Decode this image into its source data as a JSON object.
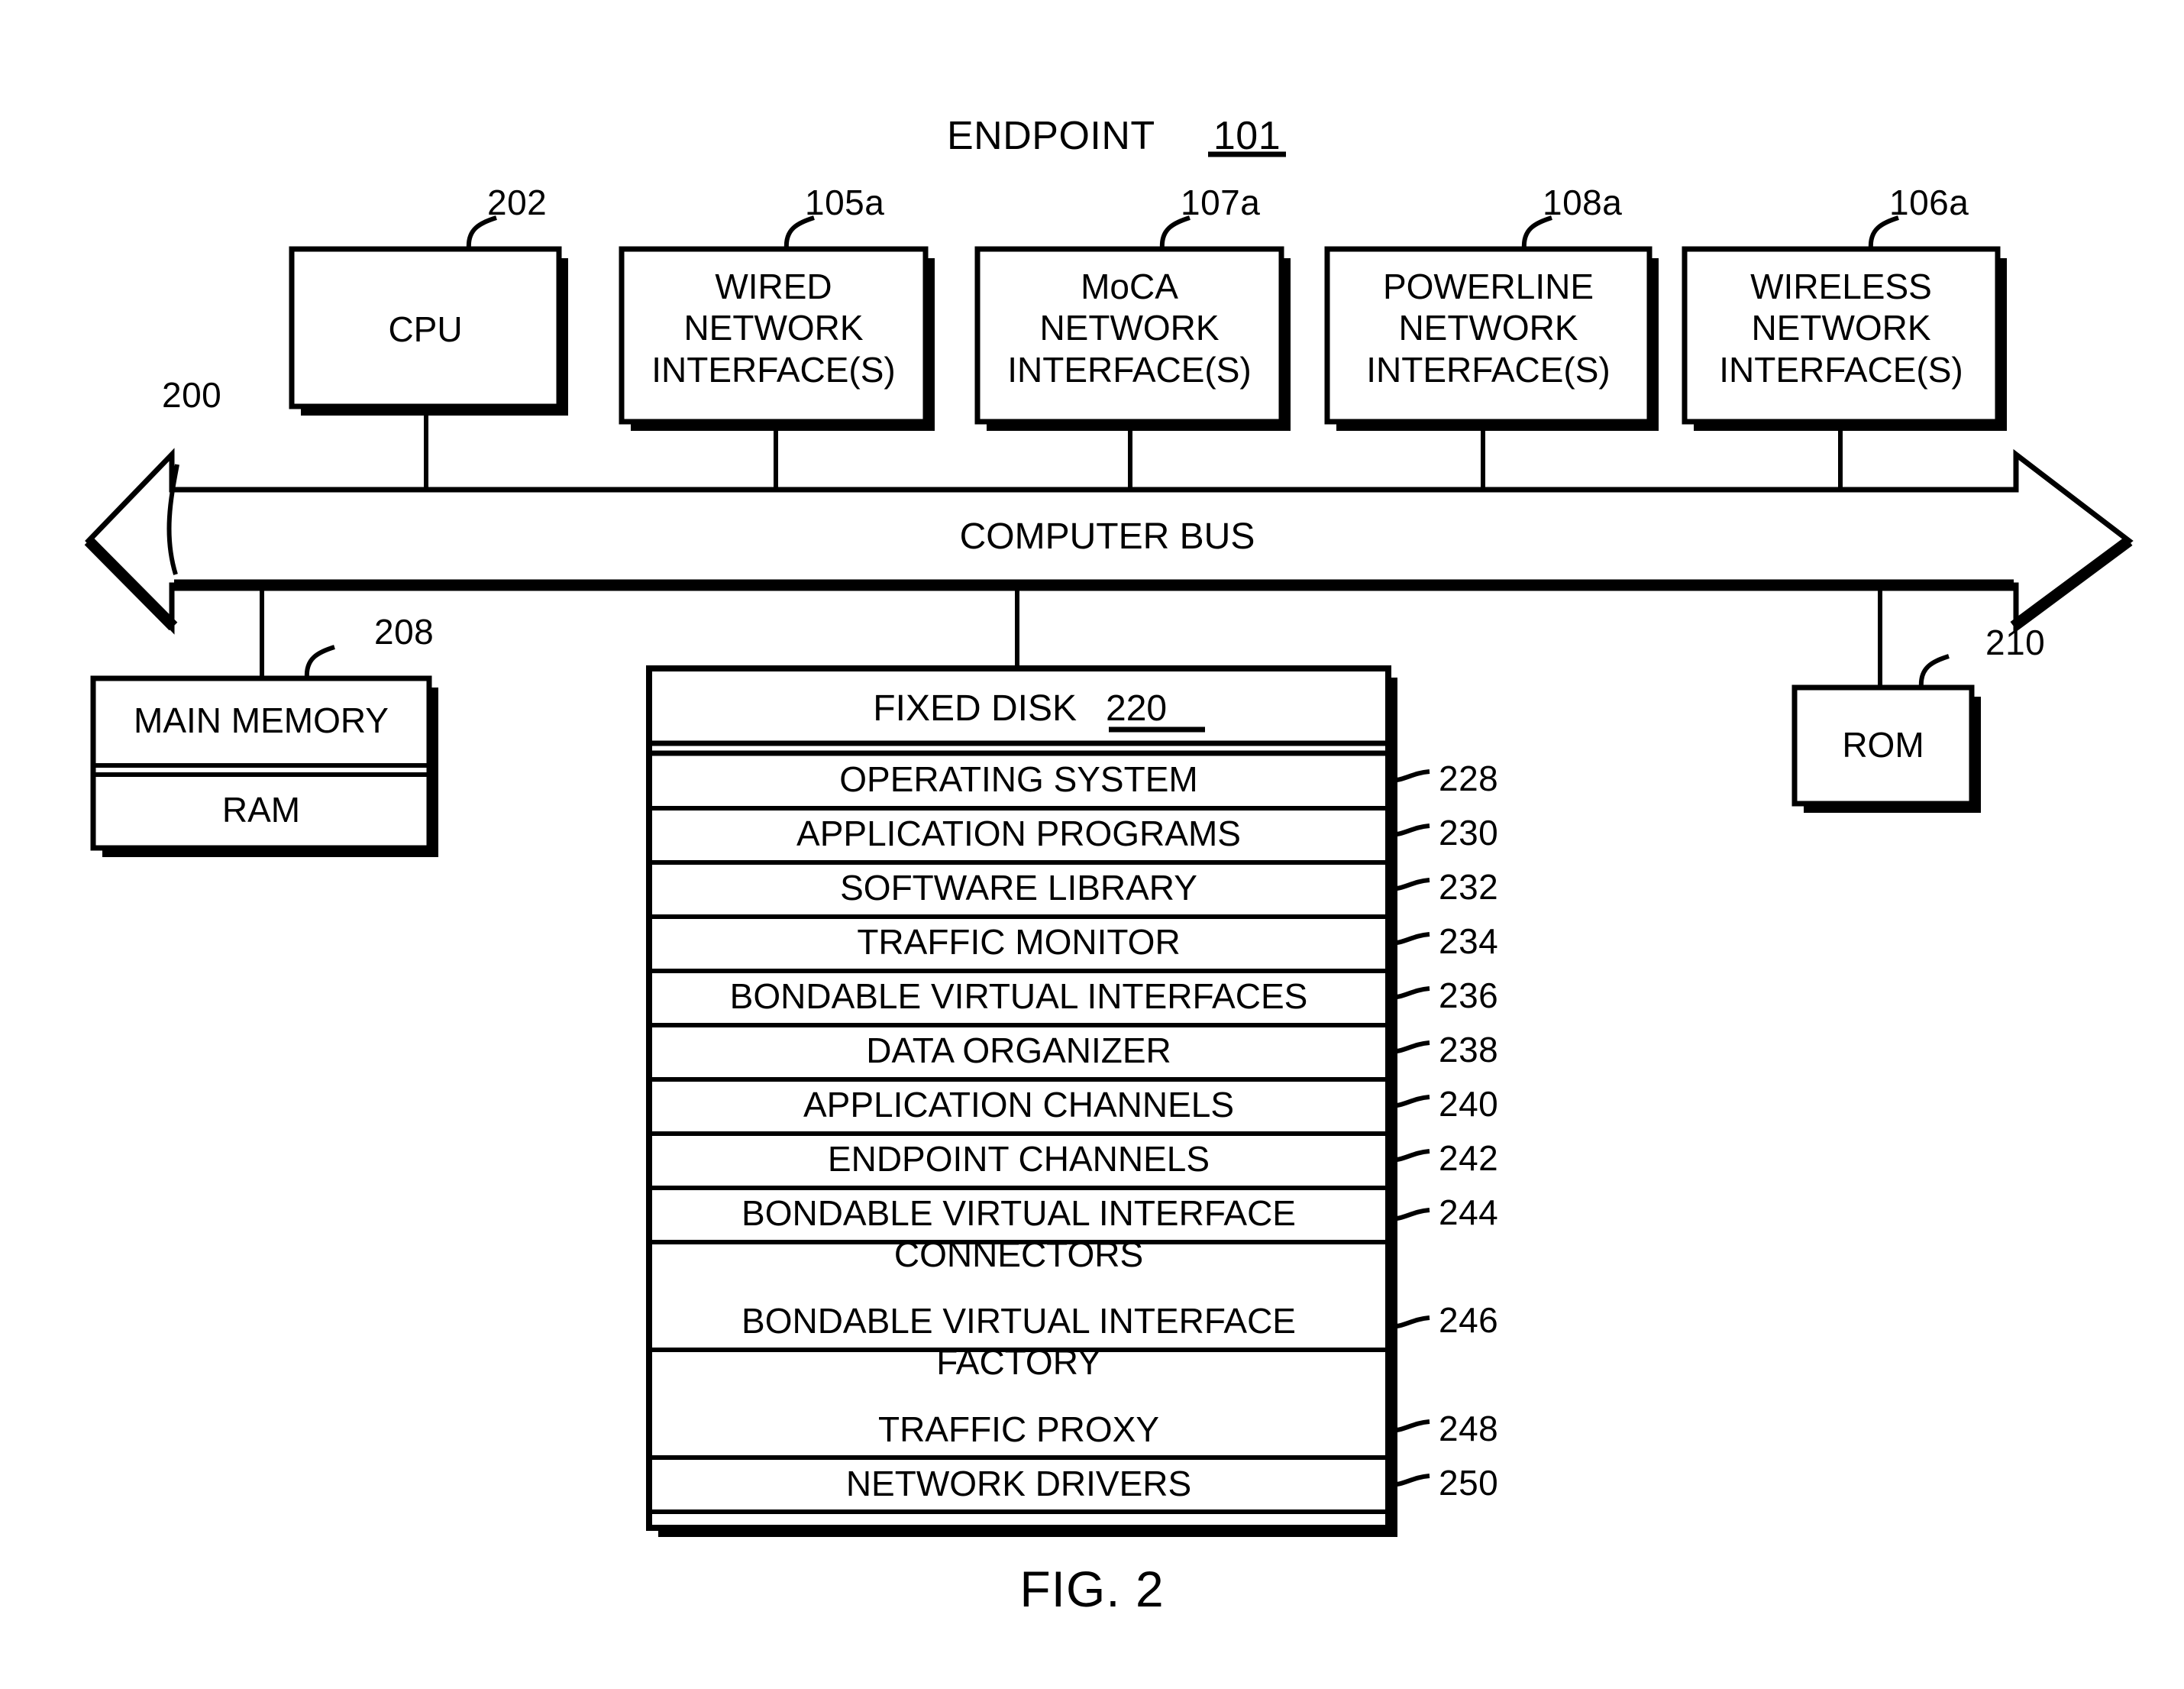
{
  "figure": {
    "title_text": "ENDPOINT",
    "title_ref": "101",
    "caption": "FIG. 2",
    "bus_label": "COMPUTER BUS",
    "bus_ref": "200"
  },
  "top_boxes": [
    {
      "label": "CPU",
      "ref": "202"
    },
    {
      "label": "WIRED\nNETWORK\nINTERFACE(S)",
      "ref": "105a"
    },
    {
      "label": "MoCA\nNETWORK\nINTERFACE(S)",
      "ref": "107a"
    },
    {
      "label": "POWERLINE\nNETWORK\nINTERFACE(S)",
      "ref": "108a"
    },
    {
      "label": "WIRELESS\nNETWORK\nINTERFACE(S)",
      "ref": "106a"
    }
  ],
  "main_memory": {
    "title": "MAIN MEMORY",
    "ref": "208",
    "sub_label": "RAM"
  },
  "rom": {
    "label": "ROM",
    "ref": "210"
  },
  "fixed_disk": {
    "title": "FIXED DISK",
    "title_ref": "220",
    "rows": [
      {
        "label": "OPERATING SYSTEM",
        "ref": "228"
      },
      {
        "label": "APPLICATION PROGRAMS",
        "ref": "230"
      },
      {
        "label": "SOFTWARE LIBRARY",
        "ref": "232"
      },
      {
        "label": "TRAFFIC MONITOR",
        "ref": "234"
      },
      {
        "label": "BONDABLE VIRTUAL INTERFACES",
        "ref": "236"
      },
      {
        "label": "DATA ORGANIZER",
        "ref": "238"
      },
      {
        "label": "APPLICATION CHANNELS",
        "ref": "240"
      },
      {
        "label": "ENDPOINT CHANNELS",
        "ref": "242"
      },
      {
        "label": "BONDABLE VIRTUAL INTERFACE\nCONNECTORS",
        "ref": "244"
      },
      {
        "label": "BONDABLE VIRTUAL INTERFACE\nFACTORY",
        "ref": "246"
      },
      {
        "label": "TRAFFIC PROXY",
        "ref": "248"
      },
      {
        "label": "NETWORK DRIVERS",
        "ref": "250"
      }
    ]
  },
  "colors": {
    "ink": "#000000",
    "paper": "#ffffff"
  }
}
